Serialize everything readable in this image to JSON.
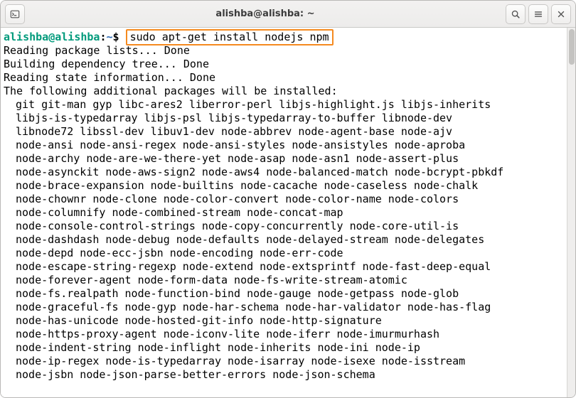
{
  "titlebar": {
    "title": "alishba@alishba: ~"
  },
  "prompt": {
    "userhost": "alishba@alishba",
    "path": "~",
    "symbol": "$"
  },
  "command": "sudo apt-get install nodejs npm",
  "output": {
    "line1": "Reading package lists... Done",
    "line2": "Building dependency tree... Done",
    "line3": "Reading state information... Done",
    "line4": "The following additional packages will be installed:"
  },
  "packages": [
    "git git-man gyp libc-ares2 liberror-perl libjs-highlight.js libjs-inherits",
    "libjs-is-typedarray libjs-psl libjs-typedarray-to-buffer libnode-dev",
    "libnode72 libssl-dev libuv1-dev node-abbrev node-agent-base node-ajv",
    "node-ansi node-ansi-regex node-ansi-styles node-ansistyles node-aproba",
    "node-archy node-are-we-there-yet node-asap node-asn1 node-assert-plus",
    "node-asynckit node-aws-sign2 node-aws4 node-balanced-match node-bcrypt-pbkdf",
    "node-brace-expansion node-builtins node-cacache node-caseless node-chalk",
    "node-chownr node-clone node-color-convert node-color-name node-colors",
    "node-columnify node-combined-stream node-concat-map",
    "node-console-control-strings node-copy-concurrently node-core-util-is",
    "node-dashdash node-debug node-defaults node-delayed-stream node-delegates",
    "node-depd node-ecc-jsbn node-encoding node-err-code",
    "node-escape-string-regexp node-extend node-extsprintf node-fast-deep-equal",
    "node-forever-agent node-form-data node-fs-write-stream-atomic",
    "node-fs.realpath node-function-bind node-gauge node-getpass node-glob",
    "node-graceful-fs node-gyp node-har-schema node-har-validator node-has-flag",
    "node-has-unicode node-hosted-git-info node-http-signature",
    "node-https-proxy-agent node-iconv-lite node-iferr node-imurmurhash",
    "node-indent-string node-inflight node-inherits node-ini node-ip",
    "node-ip-regex node-is-typedarray node-isarray node-isexe node-isstream",
    "node-jsbn node-json-parse-better-errors node-json-schema"
  ]
}
